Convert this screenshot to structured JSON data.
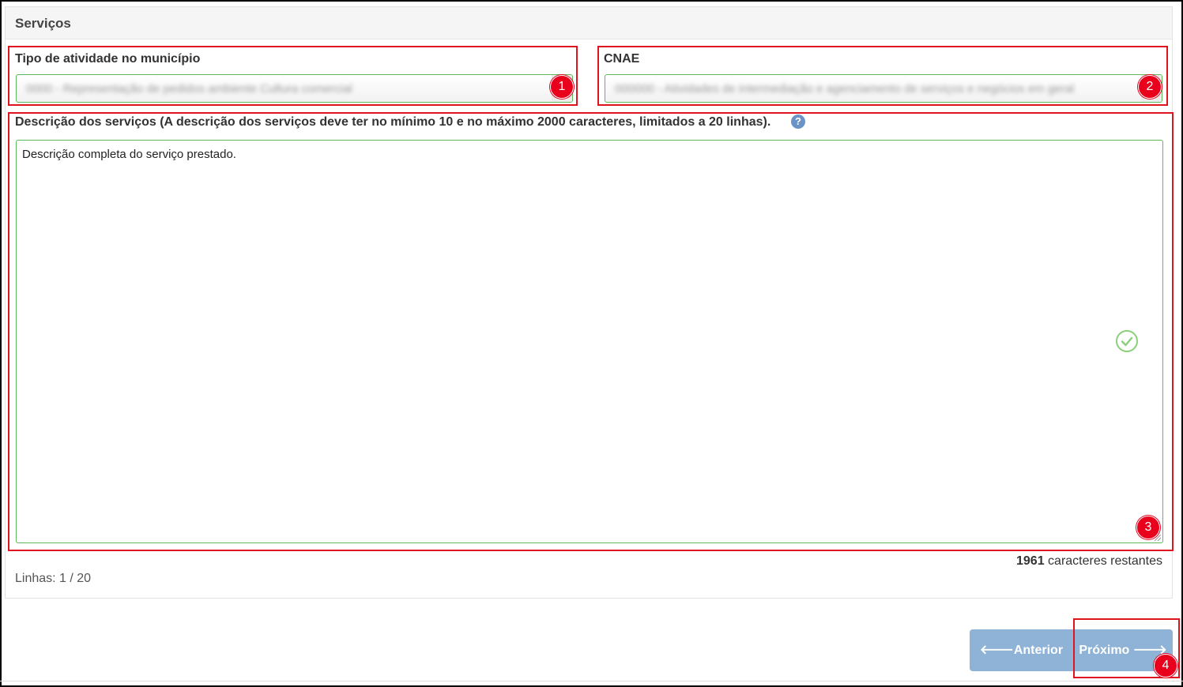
{
  "panel": {
    "title": "Serviços"
  },
  "fields": {
    "tipo_atividade": {
      "label": "Tipo de atividade no município",
      "value": "0000 - Representação de pedidos ambiente Cultura comercial",
      "badge": "1"
    },
    "cnae": {
      "label": "CNAE",
      "value": "000000 - Atividades de intermediação e agenciamento de serviços e negócios em geral",
      "badge": "2"
    },
    "descricao": {
      "label": "Descrição dos serviços (A descrição dos serviços deve ter no mínimo 10 e no máximo 2000 caracteres, limitados a 20 linhas).",
      "help": "?",
      "value": "Descrição completa do serviço prestado.",
      "badge": "3"
    }
  },
  "counter": {
    "remaining": "1961",
    "suffix": " caracteres restantes"
  },
  "lines": "Linhas: 1 / 20",
  "nav": {
    "prev_label": "🡐Anterior",
    "next_label": "Próximo 🡒",
    "badge": "4"
  },
  "colors": {
    "annotation_red": "#e0141e",
    "valid_green": "#5fb85c",
    "button_blue": "#8fb3d6"
  }
}
